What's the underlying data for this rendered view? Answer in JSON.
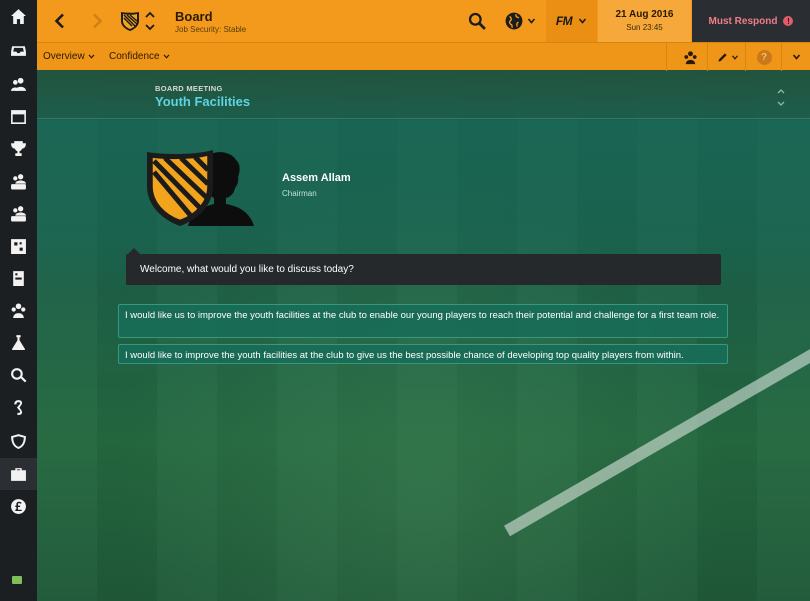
{
  "topbar": {
    "title": "Board",
    "subtitle": "Job Security: Stable",
    "fm_label": "FM",
    "date": "21 Aug 2016",
    "time": "Sun 23:45",
    "respond_label": "Must Respond",
    "respond_badge": "!",
    "colors": {
      "accent": "#f39a1c",
      "respond": "#f07d8a",
      "dark": "#2a2e33"
    }
  },
  "subbar": {
    "tabs": [
      {
        "label": "Overview"
      },
      {
        "label": "Confidence"
      }
    ],
    "help_label": "?"
  },
  "sidebar": {
    "items": [
      {
        "icon": "home-icon"
      },
      {
        "icon": "inbox-icon"
      },
      {
        "icon": "squad-icon"
      },
      {
        "icon": "schedule-icon"
      },
      {
        "icon": "trophy-icon"
      },
      {
        "icon": "u23-squad-icon"
      },
      {
        "icon": "u18-squad-icon"
      },
      {
        "icon": "tactics-icon"
      },
      {
        "icon": "training-icon"
      },
      {
        "icon": "staff-icon"
      },
      {
        "icon": "scouting-icon"
      },
      {
        "icon": "search-icon"
      },
      {
        "icon": "transfers-icon"
      },
      {
        "icon": "club-info-icon"
      },
      {
        "icon": "board-icon"
      },
      {
        "icon": "finances-icon"
      }
    ],
    "active_index": 14
  },
  "meeting": {
    "caption": "BOARD MEETING",
    "title": "Youth Facilities",
    "title_color": "#5fd3e0"
  },
  "chairman": {
    "name": "Assem Allam",
    "role": "Chairman"
  },
  "dialog": {
    "prompt": "Welcome, what would you like to discuss today?",
    "options": [
      {
        "text": "I would like us to improve the youth facilities at the club to enable our young players to reach their potential and challenge for a first team role."
      },
      {
        "text": "I would like to improve the youth facilities at the club to give us the best possible chance of developing top quality players from within."
      }
    ]
  }
}
